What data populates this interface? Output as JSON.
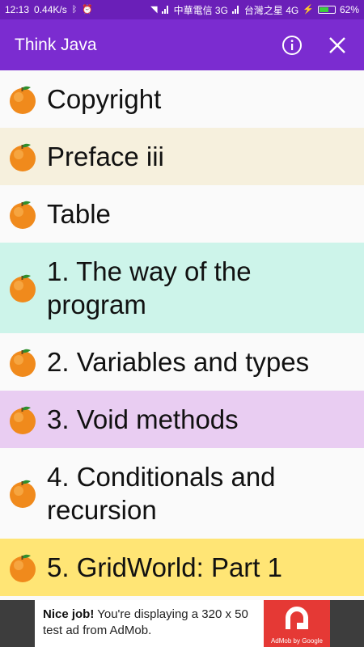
{
  "status_bar": {
    "time": "12:13",
    "speed": "0.44K/s",
    "carrier1": "中華電信 3G",
    "carrier2": "台灣之星 4G",
    "battery": "62%",
    "battery_level": 0.62
  },
  "app_bar": {
    "title": "Think Java",
    "info_icon": "info-circle-icon",
    "close_icon": "close-icon"
  },
  "chapters": [
    {
      "label": "Copyright",
      "bg": "#fafafa"
    },
    {
      "label": "Preface iii",
      "bg": "#f6f0dd"
    },
    {
      "label": "Table",
      "bg": "#fafafa"
    },
    {
      "label": "1. The way of the program",
      "bg": "#cdf4ea"
    },
    {
      "label": "2. Variables and types",
      "bg": "#fafafa"
    },
    {
      "label": "3. Void methods",
      "bg": "#e9cdf2"
    },
    {
      "label": "4. Conditionals and recursion",
      "bg": "#fafafa"
    },
    {
      "label": "5. GridWorld: Part 1",
      "bg": "#ffe575"
    }
  ],
  "ad": {
    "bold": "Nice job!",
    "text": " You're displaying a 320 x 50 test ad from AdMob.",
    "brand": "AdMob by Google"
  },
  "colors": {
    "status_bar": "#6a1fb8",
    "app_bar": "#7b2cd0"
  }
}
